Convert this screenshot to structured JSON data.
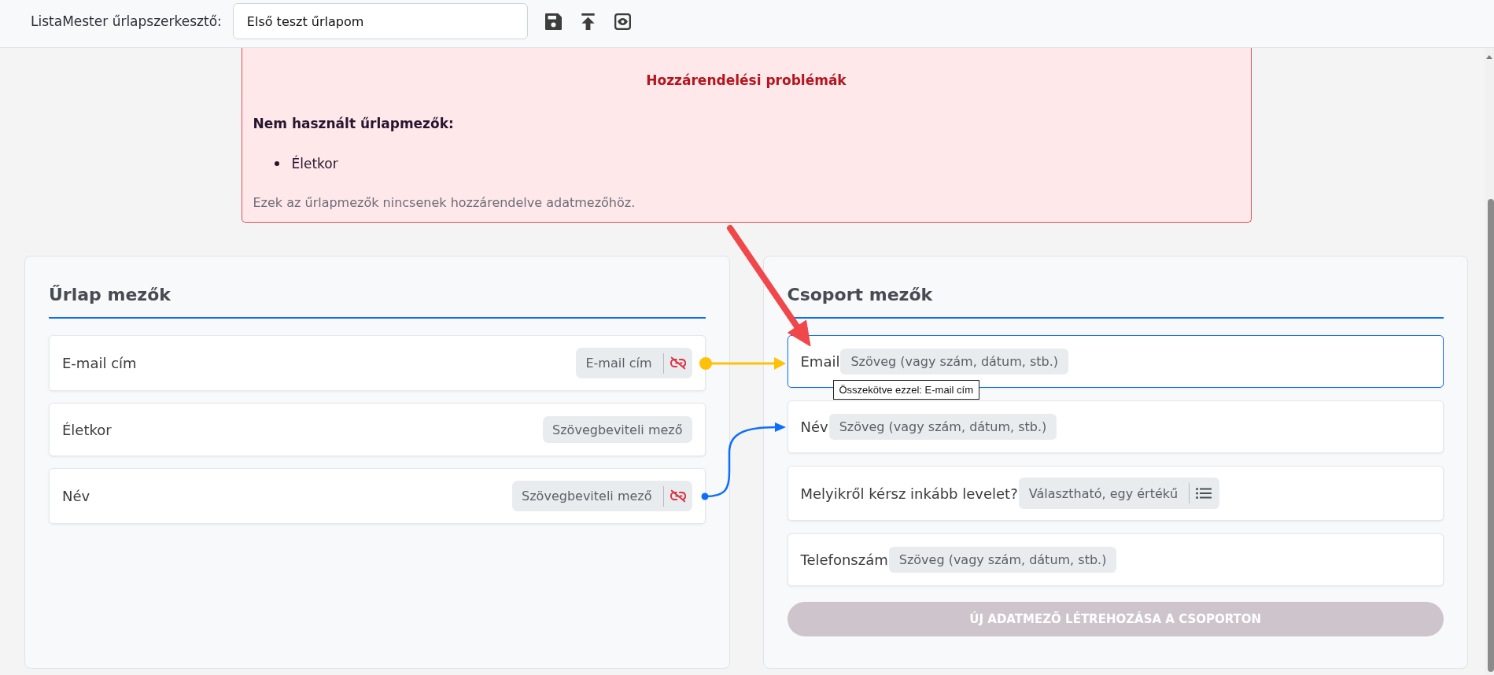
{
  "header": {
    "title": "ListaMester űrlapszerkesztő:",
    "form_name": "Első teszt űrlapom"
  },
  "problems": {
    "title": "Hozzárendelési problémák",
    "subtitle": "Nem használt űrlapmezők:",
    "items": [
      "Életkor"
    ],
    "note": "Ezek az űrlapmezők nincsenek hozzárendelve adatmezőhöz."
  },
  "form_panel": {
    "title": "Űrlap mezők",
    "fields": [
      {
        "label": "E-mail cím",
        "data_type": "E-mail cím",
        "linked": true
      },
      {
        "label": "Életkor",
        "data_type": "Szövegbeviteli mező",
        "linked": false
      },
      {
        "label": "Név",
        "data_type": "Szövegbeviteli mező",
        "linked": true
      }
    ]
  },
  "group_panel": {
    "title": "Csoport mezők",
    "fields": [
      {
        "label": "Email",
        "data_type": "Szöveg (vagy szám, dátum, stb.)",
        "kind": "text",
        "selected": true,
        "tooltip": "Összekötve ezzel: E-mail cím"
      },
      {
        "label": "Név",
        "data_type": "Szöveg (vagy szám, dátum, stb.)",
        "kind": "text",
        "selected": false
      },
      {
        "label": "Melyikről kérsz inkább levelet?",
        "data_type": "Választható, egy értékű",
        "kind": "choice",
        "selected": false
      },
      {
        "label": "Telefonszám",
        "data_type": "Szöveg (vagy szám, dátum, stb.)",
        "kind": "text",
        "selected": false
      }
    ],
    "create_button": {
      "label": "ÚJ ADATMEZŐ LÉTREHOZÁSA A CSOPORTON",
      "disabled": true
    }
  },
  "connectors": [
    {
      "kind": "straight",
      "color": "#ffc107"
    },
    {
      "kind": "curved",
      "color": "#0d6efd"
    }
  ]
}
